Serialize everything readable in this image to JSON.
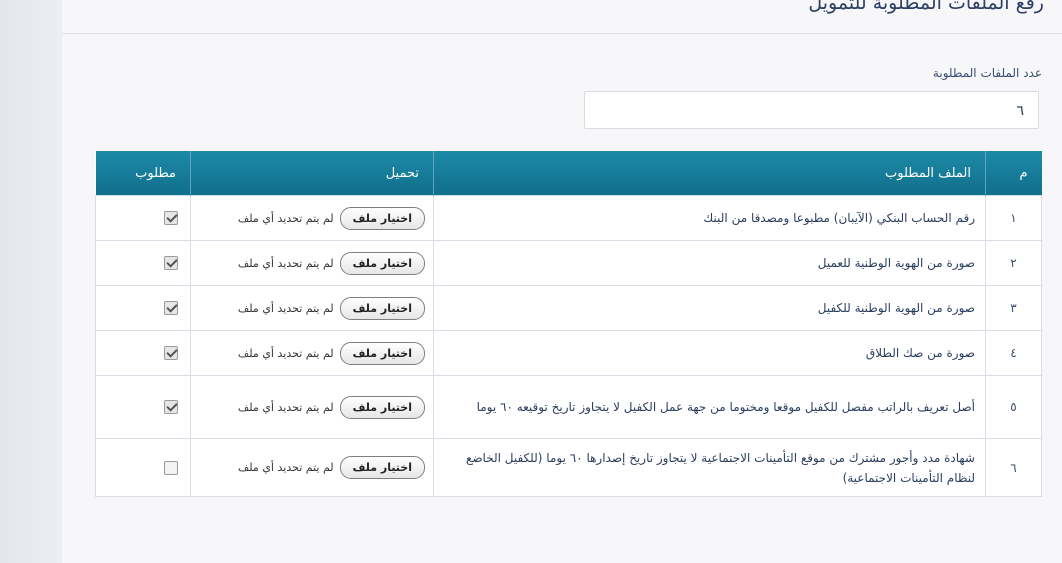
{
  "page": {
    "title": "رفع الملفات المطلوبة للتمويل"
  },
  "count": {
    "label": "عدد الملفات المطلوبة",
    "value": "٦"
  },
  "table": {
    "headers": {
      "num": "م",
      "file": "الملف المطلوب",
      "upload": "تحميل",
      "required": "مطلوب"
    },
    "choose_label": "اختيار ملف",
    "no_file_label": "لم يتم تحديد أي ملف",
    "rows": [
      {
        "num": "١",
        "file": "رقم الحساب البنكي (الآيبان) مطبوعا ومصدقا من البنك",
        "required": true
      },
      {
        "num": "٢",
        "file": "صورة من الهوية الوطنية للعميل",
        "required": true
      },
      {
        "num": "٣",
        "file": "صورة من الهوية الوطنية للكفيل",
        "required": true
      },
      {
        "num": "٤",
        "file": "صورة من صك الطلاق",
        "required": true
      },
      {
        "num": "٥",
        "file": "أصل تعريف بالراتب مفصل للكفيل موقعا ومختوما من جهة عمل الكفيل لا يتجاوز تاريخ توقيعه ٦٠ يوما",
        "required": true
      },
      {
        "num": "٦",
        "file": "شهادة مدد وأجور مشترك من موقع التأمينات الاجتماعية لا يتجاوز تاريخ إصدارها ٦٠ يوما (للكفيل الخاضع لنظام التأمينات الاجتماعية)",
        "required": false
      }
    ]
  }
}
